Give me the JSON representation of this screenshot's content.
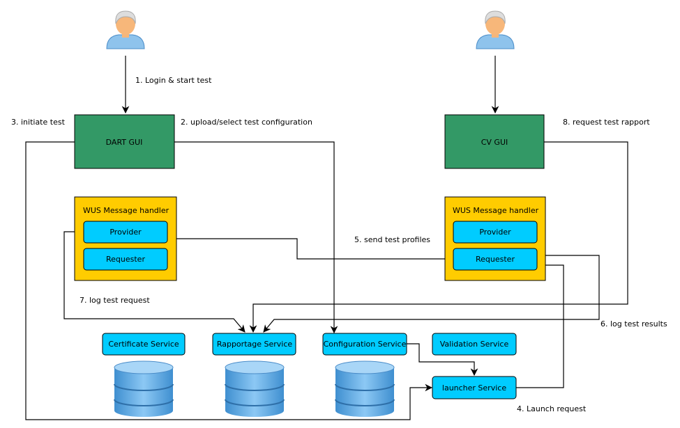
{
  "colors": {
    "gui": "#339966",
    "handler": "#ffcc00",
    "service": "#00ccff",
    "line": "#000000"
  },
  "nodes": {
    "dart_gui": "DART GUI",
    "cv_gui": "CV GUI",
    "left_handler": {
      "title": "WUS Message handler",
      "provider": "Provider",
      "requester": "Requester"
    },
    "right_handler": {
      "title": "WUS Message handler",
      "provider": "Provider",
      "requester": "Requester"
    },
    "certificate": "Certificate Service",
    "rapportage": "Rapportage Service",
    "configuration": "Configuration Service",
    "validation": "Validation Service",
    "launcher": "launcher Service"
  },
  "edges": {
    "e1": "1. Login & start test",
    "e2": "2. upload/select test configuration",
    "e3": "3. initiate test",
    "e4": "4. Launch request",
    "e5": "5. send test profiles",
    "e6": "6. log test results",
    "e7": "7. log test request",
    "e8": "8. request test rapport"
  },
  "icons": [
    "user-icon",
    "user-icon",
    "database-icon",
    "database-icon",
    "database-icon"
  ]
}
